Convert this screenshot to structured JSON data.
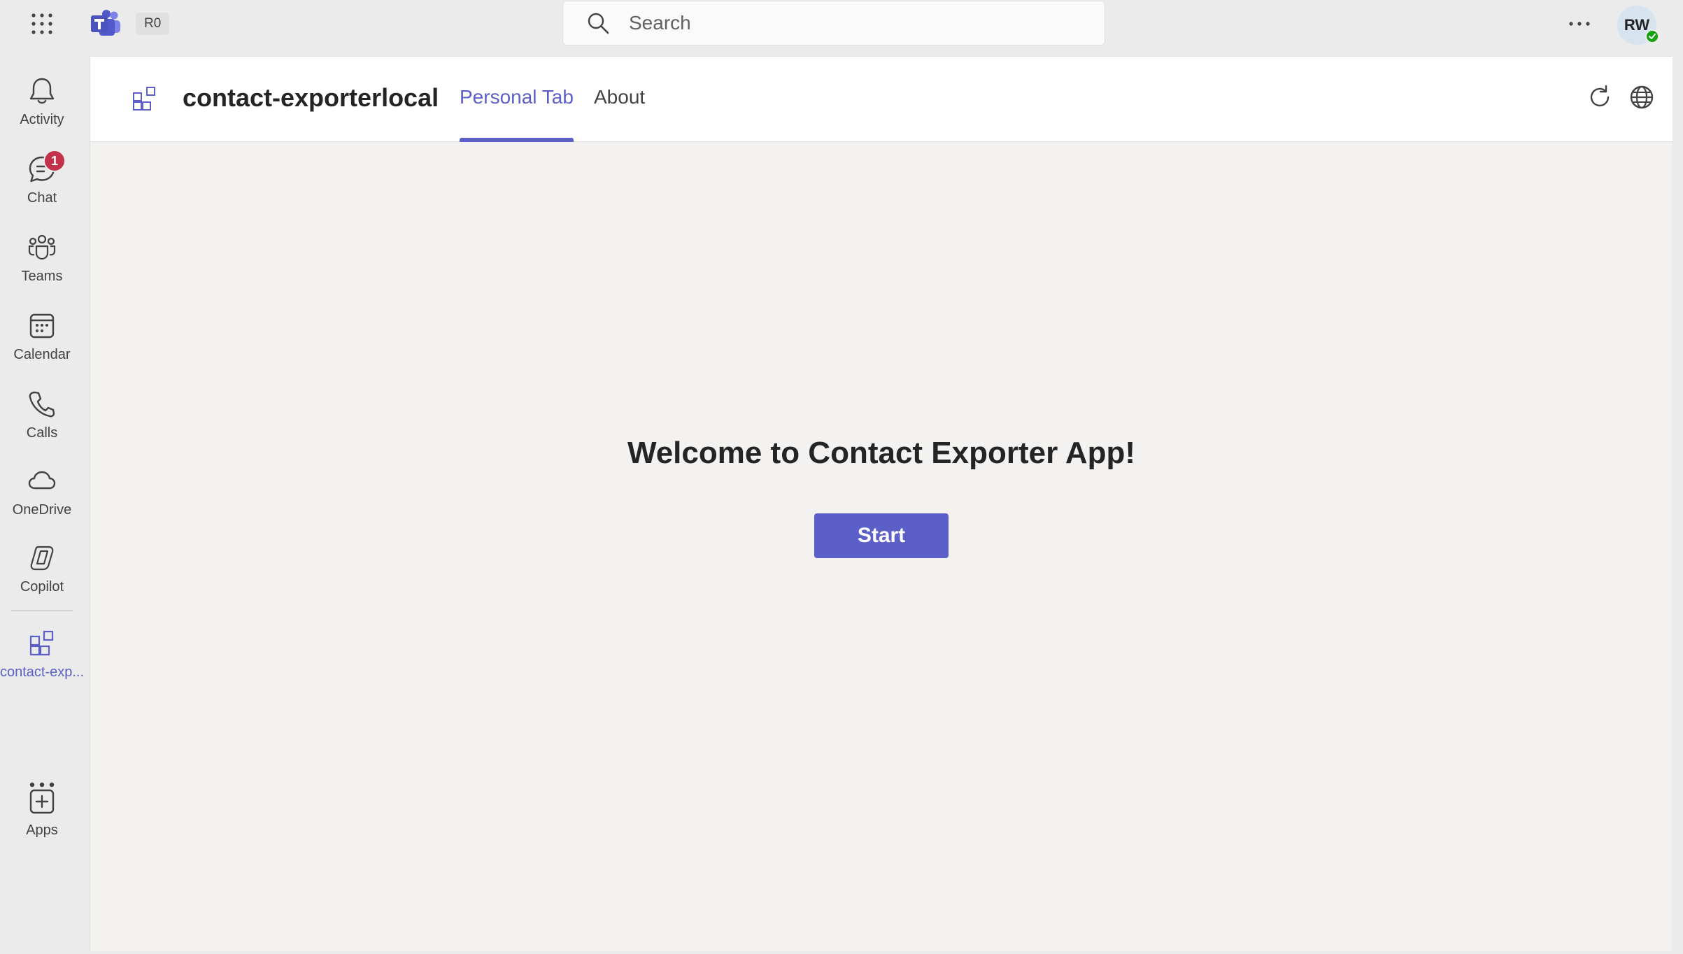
{
  "topbar": {
    "org_badge": "R0",
    "search_placeholder": "Search",
    "avatar_initials": "RW"
  },
  "rail": {
    "items": [
      {
        "label": "Activity",
        "icon": "bell-icon"
      },
      {
        "label": "Chat",
        "icon": "chat-icon",
        "badge": "1"
      },
      {
        "label": "Teams",
        "icon": "teams-icon"
      },
      {
        "label": "Calendar",
        "icon": "calendar-icon"
      },
      {
        "label": "Calls",
        "icon": "phone-icon"
      },
      {
        "label": "OneDrive",
        "icon": "cloud-icon"
      },
      {
        "label": "Copilot",
        "icon": "copilot-icon"
      },
      {
        "label": "contact-exp...",
        "icon": "app-grid-icon",
        "active": true
      },
      {
        "label": "Apps",
        "icon": "add-app-icon"
      }
    ]
  },
  "header": {
    "app_title": "contact-exporterlocal",
    "tabs": [
      {
        "label": "Personal Tab",
        "active": true
      },
      {
        "label": "About",
        "active": false
      }
    ]
  },
  "content": {
    "welcome": "Welcome to Contact Exporter App!",
    "start_label": "Start"
  },
  "colors": {
    "accent": "#5b5fc7",
    "badge": "#c4314b",
    "presence": "#13a10e"
  }
}
